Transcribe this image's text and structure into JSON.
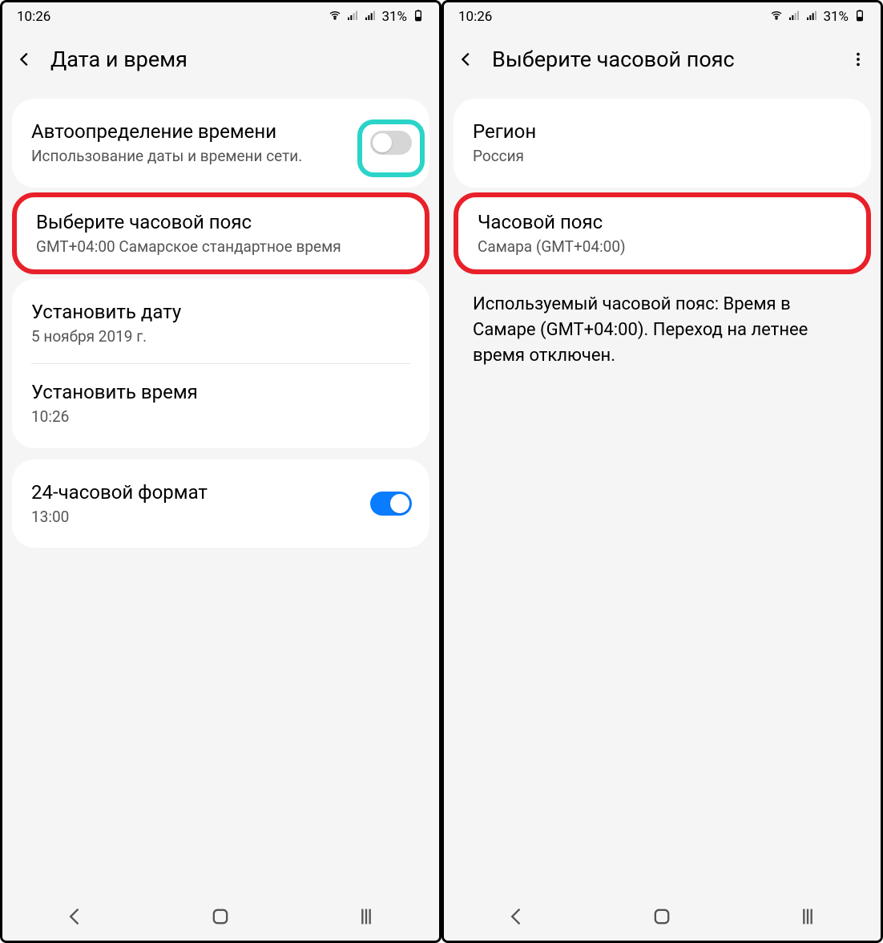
{
  "statusbar": {
    "time": "10:26",
    "battery": "31%"
  },
  "screen1": {
    "title": "Дата и время",
    "auto_time_title": "Автоопределение времени",
    "auto_time_sub": "Использование даты и времени сети.",
    "tz_title": "Выберите часовой пояс",
    "tz_sub": "GMT+04:00 Самарское стандартное время",
    "set_date_title": "Установить дату",
    "set_date_sub": "5 ноября 2019 г.",
    "set_time_title": "Установить время",
    "set_time_sub": "10:26",
    "format24_title": "24-часовой формат",
    "format24_sub": "13:00"
  },
  "screen2": {
    "title": "Выберите часовой пояс",
    "region_title": "Регион",
    "region_sub": "Россия",
    "tz_title": "Часовой пояс",
    "tz_sub": "Самара (GMT+04:00)",
    "info": "Используемый часовой пояс: Время в Самаре (GMT+04:00). Переход на летнее время отключен."
  }
}
